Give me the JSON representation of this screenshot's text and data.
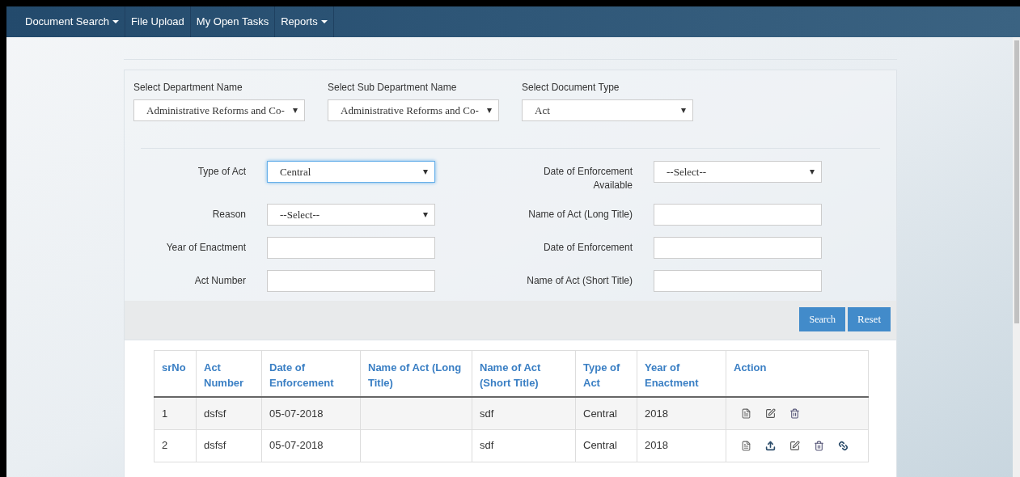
{
  "nav": [
    {
      "label": "Document Search",
      "dropdown": true
    },
    {
      "label": "File Upload",
      "dropdown": false
    },
    {
      "label": "My Open Tasks",
      "dropdown": false
    },
    {
      "label": "Reports",
      "dropdown": true
    }
  ],
  "top_filters": [
    {
      "label": "Select Department Name",
      "value": "Administrative Reforms and Co-"
    },
    {
      "label": "Select Sub Department Name",
      "value": "Administrative Reforms and Co-"
    },
    {
      "label": "Select Document Type",
      "value": "Act"
    }
  ],
  "left_fields": [
    {
      "label": "Type of Act",
      "kind": "select",
      "value": "Central",
      "focused": true
    },
    {
      "label": "Reason",
      "kind": "select",
      "value": "--Select--",
      "focused": false
    },
    {
      "label": "Year of Enactment",
      "kind": "text",
      "focused": false
    },
    {
      "label": "Act Number",
      "kind": "text",
      "focused": false
    }
  ],
  "right_fields": [
    {
      "label": "Date of Enforcement Available",
      "kind": "select",
      "value": "--Select--",
      "focused": false
    },
    {
      "label": "Name of Act (Long Title)",
      "kind": "text",
      "focused": false
    },
    {
      "label": "Date of Enforcement",
      "kind": "text",
      "focused": false
    },
    {
      "label": "Name of Act (Short Title)",
      "kind": "text",
      "focused": false
    }
  ],
  "buttons": [
    "Search",
    "Reset"
  ],
  "table": {
    "columns": [
      "srNo",
      "Act Number",
      "Date of Enforcement",
      "Name of Act (Long Title)",
      "Name of Act (Short Title)",
      "Type of Act",
      "Year of Enactment",
      "Action"
    ],
    "rows": [
      {
        "cells": [
          "1",
          "dsfsf",
          "05-07-2018",
          null,
          "sdf",
          "Central",
          "2018"
        ],
        "actions": [
          {
            "kind": "view"
          },
          {
            "kind": "edit"
          },
          {
            "kind": "delete"
          }
        ]
      },
      {
        "cells": [
          "2",
          "dsfsf",
          "05-07-2018",
          null,
          "sdf",
          "Central",
          "2018"
        ],
        "actions": [
          {
            "kind": "view"
          },
          {
            "kind": "upload"
          },
          {
            "kind": "edit"
          },
          {
            "kind": "delete"
          },
          {
            "kind": "link"
          }
        ]
      }
    ]
  }
}
